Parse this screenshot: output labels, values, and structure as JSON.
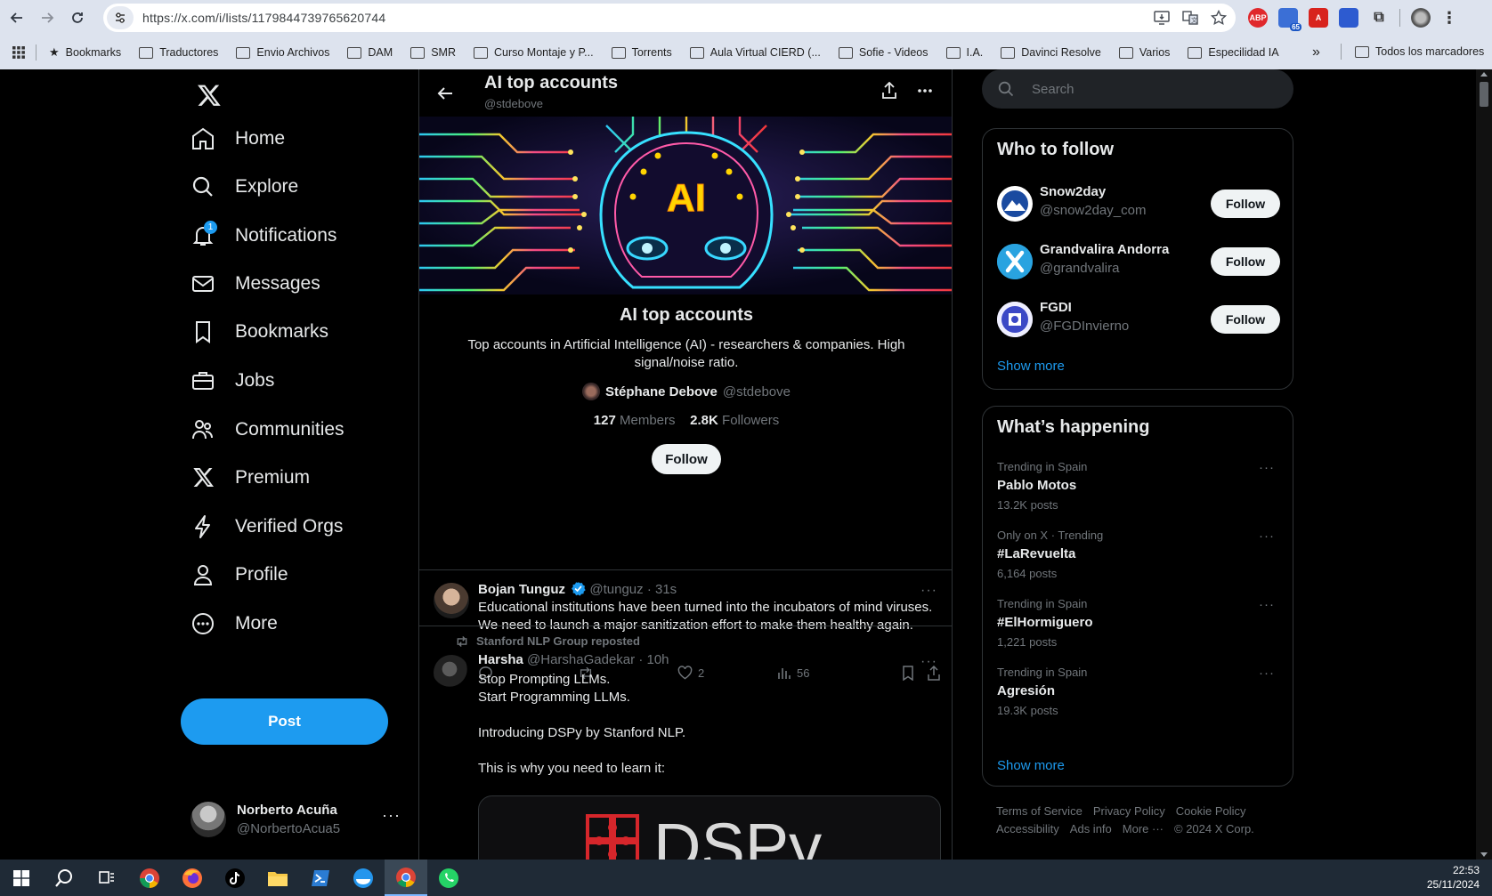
{
  "browser": {
    "url": "https://x.com/i/lists/1179844739765620744",
    "bookmarks": [
      "Bookmarks",
      "Traductores",
      "Envio Archivos",
      "DAM",
      "SMR",
      "Curso Montaje y P...",
      "Torrents",
      "Aula Virtual CIERD (...",
      "Sofie - Videos",
      "I.A.",
      "Davinci Resolve",
      "Varios",
      "Especilidad IA"
    ],
    "all_bookmarks": "Todos los marcadores",
    "overflow": "»",
    "extensions": {
      "abp": "ABP",
      "badge_count": "65"
    }
  },
  "nav": {
    "items": [
      {
        "label": "Home",
        "icon": "home-icon"
      },
      {
        "label": "Explore",
        "icon": "search-icon"
      },
      {
        "label": "Notifications",
        "icon": "bell-icon",
        "badge": "1"
      },
      {
        "label": "Messages",
        "icon": "mail-icon"
      },
      {
        "label": "Bookmarks",
        "icon": "bookmark-icon"
      },
      {
        "label": "Jobs",
        "icon": "briefcase-icon"
      },
      {
        "label": "Communities",
        "icon": "people-icon"
      },
      {
        "label": "Premium",
        "icon": "x-logo-icon"
      },
      {
        "label": "Verified Orgs",
        "icon": "lightning-icon"
      },
      {
        "label": "Profile",
        "icon": "person-icon"
      },
      {
        "label": "More",
        "icon": "more-circle-icon"
      }
    ],
    "post_label": "Post",
    "account": {
      "name": "Norberto Acuña",
      "handle": "@NorbertoAcua5"
    }
  },
  "list": {
    "title": "AI top accounts",
    "handle": "@stdebove",
    "name": "AI top accounts",
    "description": "Top accounts in Artificial Intelligence (AI) - researchers & companies. High signal/noise ratio.",
    "owner_name": "Stéphane Debove",
    "owner_handle": "@stdebove",
    "members_count": "127",
    "members_label": "Members",
    "followers_count": "2.8K",
    "followers_label": "Followers",
    "follow_label": "Follow",
    "banner_text": "AI"
  },
  "tweets": [
    {
      "name": "Bojan Tunguz",
      "handle": "@tunguz",
      "time": "· 31s",
      "text": "Educational institutions have been turned into the incubators of mind viruses. We need to launch a major sanitization effort to make them healthy again.",
      "likes": "2",
      "views": "56"
    },
    {
      "repost_by": "Stanford NLP Group reposted",
      "name": "Harsha",
      "handle": "@HarshaGadekar",
      "time": "· 10h",
      "text": "Stop Prompting LLMs.\nStart Programming LLMs.\n\nIntroducing DSPy by Stanford NLP.\n\nThis is why you need to learn it:",
      "card_text": "DSPy"
    }
  ],
  "sidebar": {
    "search_placeholder": "Search",
    "who_to_follow": {
      "title": "Who to follow",
      "accounts": [
        {
          "name": "Snow2day",
          "handle": "@snow2day_com",
          "follow": "Follow"
        },
        {
          "name": "Grandvalira Andorra",
          "handle": "@grandvalira",
          "follow": "Follow"
        },
        {
          "name": "FGDI",
          "handle": "@FGDInvierno",
          "follow": "Follow"
        }
      ],
      "show_more": "Show more"
    },
    "happening": {
      "title": "What’s happening",
      "trends": [
        {
          "context": "Trending in Spain",
          "name": "Pablo Motos",
          "count": "13.2K posts"
        },
        {
          "context": "Only on X · Trending",
          "name": "#LaRevuelta",
          "count": "6,164 posts"
        },
        {
          "context": "Trending in Spain",
          "name": "#ElHormiguero",
          "count": "1,221 posts"
        },
        {
          "context": "Trending in Spain",
          "name": "Agresión",
          "count": "19.3K posts"
        }
      ],
      "show_more": "Show more"
    },
    "footer": [
      "Terms of Service",
      "Privacy Policy",
      "Cookie Policy",
      "Accessibility",
      "Ads info",
      "More ···",
      "© 2024 X Corp."
    ]
  },
  "taskbar": {
    "time": "22:53",
    "date": "25/11/2024"
  },
  "colors": {
    "accent": "#1d9bf0",
    "background": "#000000",
    "border": "#2f3336",
    "muted": "#71767b"
  }
}
